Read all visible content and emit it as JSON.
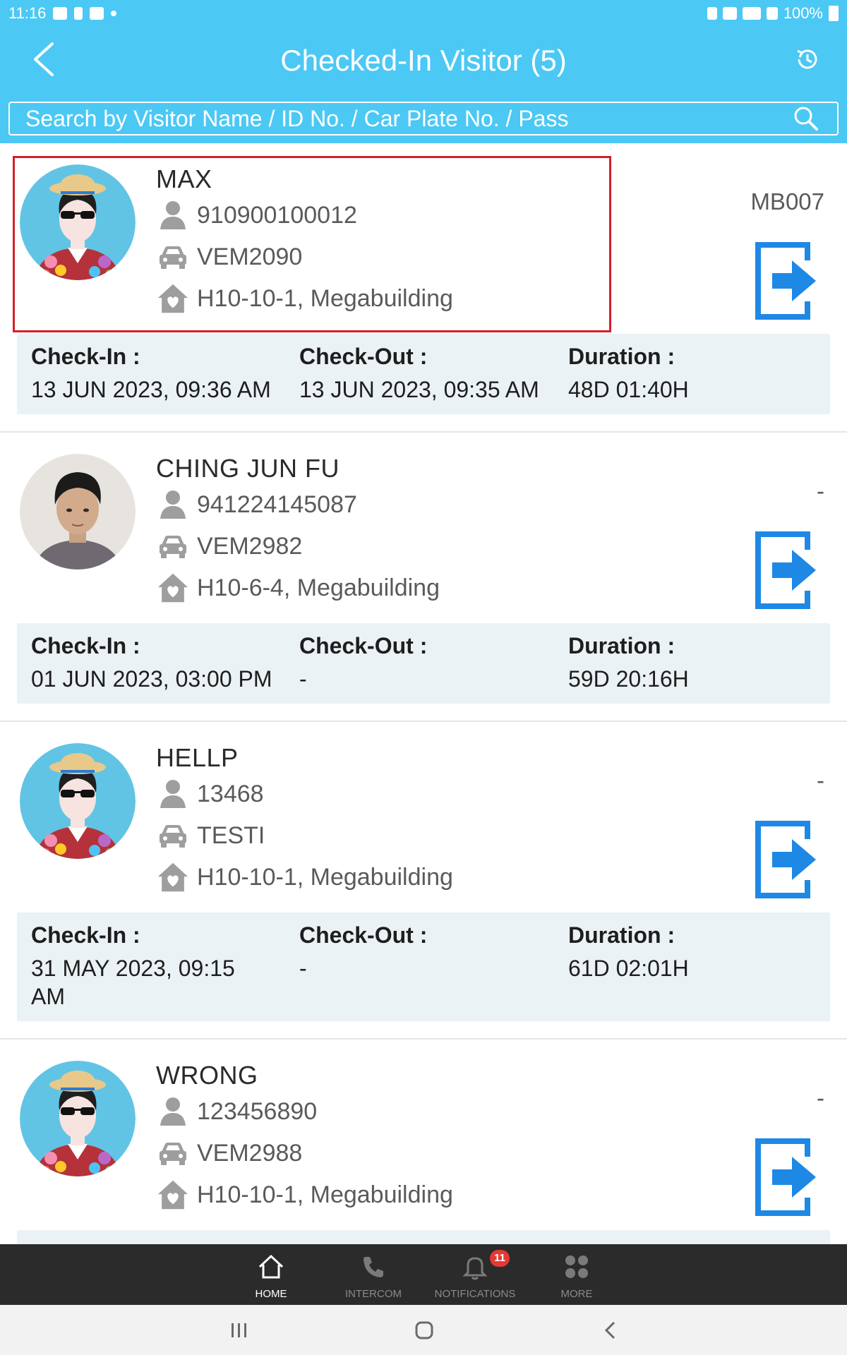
{
  "status_bar": {
    "time": "11:16",
    "battery": "100%"
  },
  "header": {
    "title": "Checked-In Visitor (5)"
  },
  "search": {
    "placeholder": "Search by Visitor Name / ID No. / Car Plate No. / Pass"
  },
  "labels": {
    "check_in": "Check-In :",
    "check_out": "Check-Out :",
    "duration": "Duration :"
  },
  "visitors": [
    {
      "name": "MAX",
      "id_no": "910900100012",
      "car_plate": "VEM2090",
      "unit": "H10-10-1, Megabuilding",
      "pass": "MB007",
      "check_in": "13 JUN 2023, 09:36 AM",
      "check_out": "13 JUN 2023, 09:35 AM",
      "duration": "48D 01:40H",
      "avatar": "cartoon-avatar"
    },
    {
      "name": "CHING JUN FU",
      "id_no": "941224145087",
      "car_plate": "VEM2982",
      "unit": "H10-6-4, Megabuilding",
      "pass": "-",
      "check_in": "01 JUN 2023, 03:00 PM",
      "check_out": "-",
      "duration": "59D 20:16H",
      "avatar": "photo-avatar"
    },
    {
      "name": "HELLP",
      "id_no": "13468",
      "car_plate": "TESTI",
      "unit": "H10-10-1, Megabuilding",
      "pass": "-",
      "check_in": "31 MAY 2023, 09:15 AM",
      "check_out": "-",
      "duration": "61D 02:01H",
      "avatar": "cartoon-avatar"
    },
    {
      "name": "WRONG",
      "id_no": "123456890",
      "car_plate": "VEM2988",
      "unit": "H10-10-1, Megabuilding",
      "pass": "-",
      "avatar": "cartoon-avatar"
    }
  ],
  "bottom_nav": [
    {
      "label": "HOME",
      "icon": "home-icon",
      "active": true
    },
    {
      "label": "INTERCOM",
      "icon": "phone-icon"
    },
    {
      "label": "NOTIFICATIONS",
      "icon": "bell-icon",
      "badge": "11"
    },
    {
      "label": "MORE",
      "icon": "grid-icon"
    }
  ],
  "colors": {
    "primary": "#4cc8f4",
    "highlight": "#d4202a",
    "time_panel": "#ebf2f5",
    "nav_bg": "#2b2b2b",
    "badge": "#e53935"
  }
}
